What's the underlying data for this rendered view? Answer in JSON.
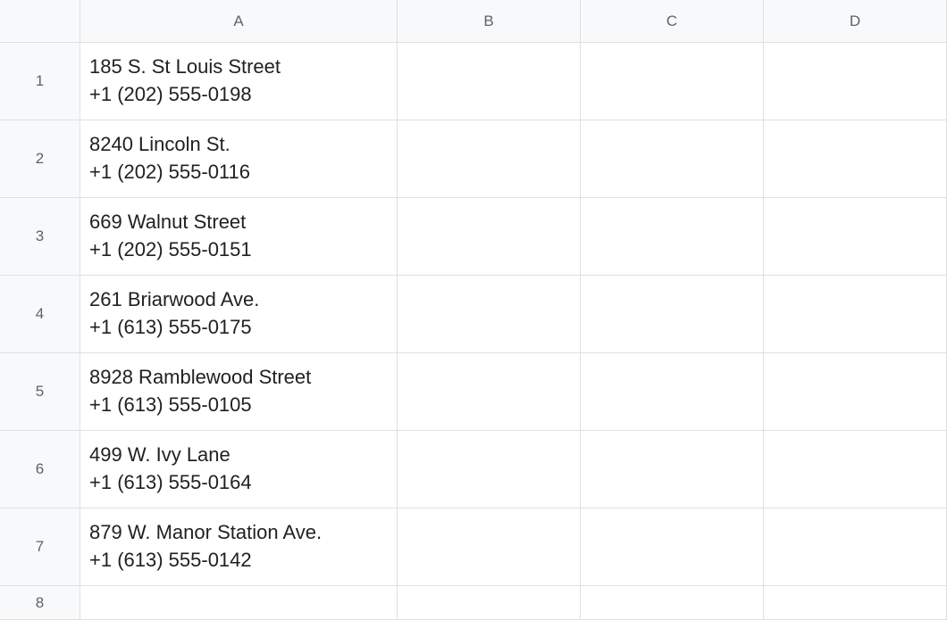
{
  "columns": {
    "a": "A",
    "b": "B",
    "c": "C",
    "d": "D"
  },
  "rows": [
    {
      "num": "1",
      "a": "185 S. St Louis Street\n+1 (202) 555-0198"
    },
    {
      "num": "2",
      "a": "8240 Lincoln St.\n+1 (202) 555-0116"
    },
    {
      "num": "3",
      "a": "669 Walnut Street\n+1 (202) 555-0151"
    },
    {
      "num": "4",
      "a": "261 Briarwood Ave.\n+1 (613) 555-0175"
    },
    {
      "num": "5",
      "a": "8928 Ramblewood Street\n+1 (613) 555-0105"
    },
    {
      "num": "6",
      "a": "499 W. Ivy Lane\n+1 (613) 555-0164"
    },
    {
      "num": "7",
      "a": "879 W. Manor Station Ave.\n+1 (613) 555-0142"
    },
    {
      "num": "8",
      "a": ""
    }
  ]
}
